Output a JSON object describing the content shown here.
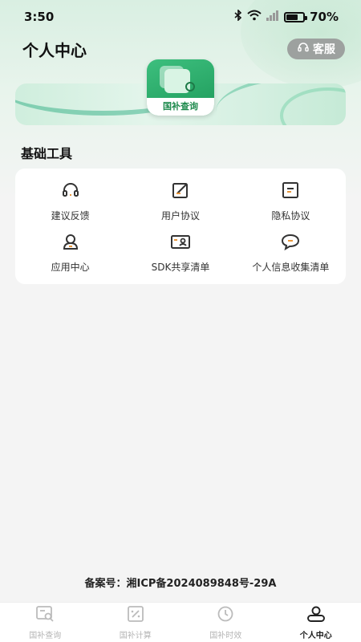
{
  "status_bar": {
    "time": "3:50",
    "battery_pct": "70%",
    "battery_level": 0.7
  },
  "header": {
    "title": "个人中心",
    "service_label": "客服"
  },
  "banner": {
    "app_badge_label": "国补查询"
  },
  "tools_section": {
    "title": "基础工具",
    "items": [
      {
        "label": "建议反馈",
        "icon": "headset-icon"
      },
      {
        "label": "用户协议",
        "icon": "edit-doc-icon"
      },
      {
        "label": "隐私协议",
        "icon": "document-icon"
      },
      {
        "label": "应用中心",
        "icon": "user-icon"
      },
      {
        "label": "SDK共享清单",
        "icon": "id-card-icon"
      },
      {
        "label": "个人信息收集清单",
        "icon": "chat-bubble-icon"
      }
    ]
  },
  "footer": {
    "icp": "备案号：湘ICP备2024089848号-29A"
  },
  "tabbar": {
    "tabs": [
      {
        "label": "国补查询",
        "icon": "search-doc-icon",
        "active": false
      },
      {
        "label": "国补计算",
        "icon": "calculator-icon",
        "active": false
      },
      {
        "label": "国补时效",
        "icon": "clock-icon",
        "active": false
      },
      {
        "label": "个人中心",
        "icon": "user-icon",
        "active": true
      }
    ]
  },
  "colors": {
    "accent": "#1e9a5a",
    "inactive": "#b5b5b5",
    "service_bg": "#9da19f"
  }
}
